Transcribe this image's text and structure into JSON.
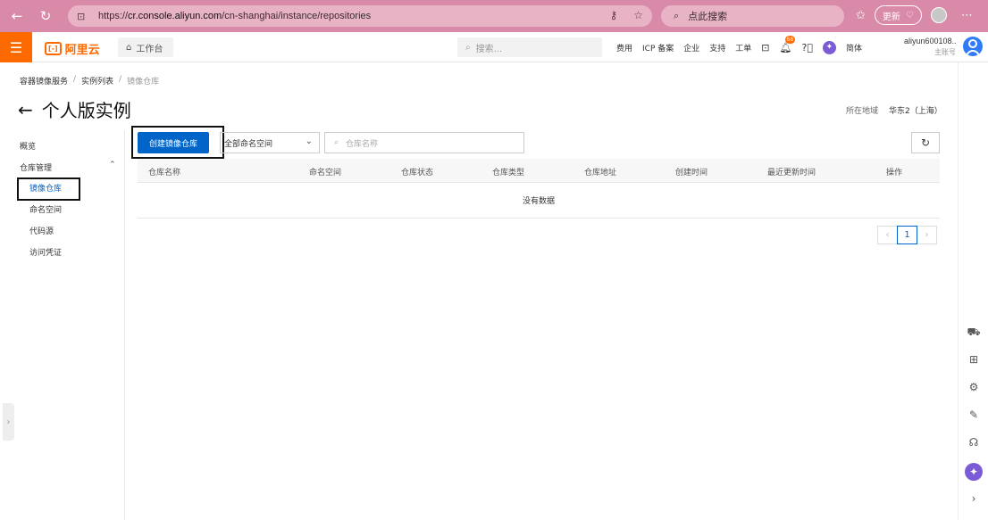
{
  "browser": {
    "url_prefix": "https://",
    "url_host": "cr.console.aliyun.com",
    "url_path": "/cn-shanghai/instance/repositories",
    "search_placeholder": "点此搜索",
    "update_label": "更新"
  },
  "topbar": {
    "logo_text": "阿里云",
    "workbench_label": "工作台",
    "search_placeholder": "搜索...",
    "nav_items": [
      "费用",
      "ICP 备案",
      "企业",
      "支持",
      "工单"
    ],
    "notification_count": "68",
    "language": "简体",
    "account_name": "aliyun600108...",
    "account_role": "主账号"
  },
  "header": {
    "breadcrumb": [
      "容器镜像服务",
      "实例列表",
      "镜像仓库"
    ],
    "title": "个人版实例",
    "region_label": "所在地域",
    "region_value": "华东2（上海）"
  },
  "sidebar": {
    "items": [
      {
        "label": "概览"
      },
      {
        "label": "仓库管理"
      },
      {
        "label": "镜像仓库"
      },
      {
        "label": "命名空间"
      },
      {
        "label": "代码源"
      },
      {
        "label": "访问凭证"
      }
    ]
  },
  "toolbar": {
    "create_label": "创建镜像仓库",
    "namespace_selected": "全部命名空间",
    "repo_search_placeholder": "仓库名称"
  },
  "table": {
    "columns": [
      "仓库名称",
      "命名空间",
      "仓库状态",
      "仓库类型",
      "仓库地址",
      "创建时间",
      "最近更新时间",
      "操作"
    ],
    "empty_text": "没有数据"
  },
  "pagination": {
    "current_page": "1",
    "prev_symbol": "‹",
    "next_symbol": "›"
  },
  "colors": {
    "brand": "#ff6a00",
    "primary": "#0064c8",
    "browser_bar": "#d98aa8"
  }
}
